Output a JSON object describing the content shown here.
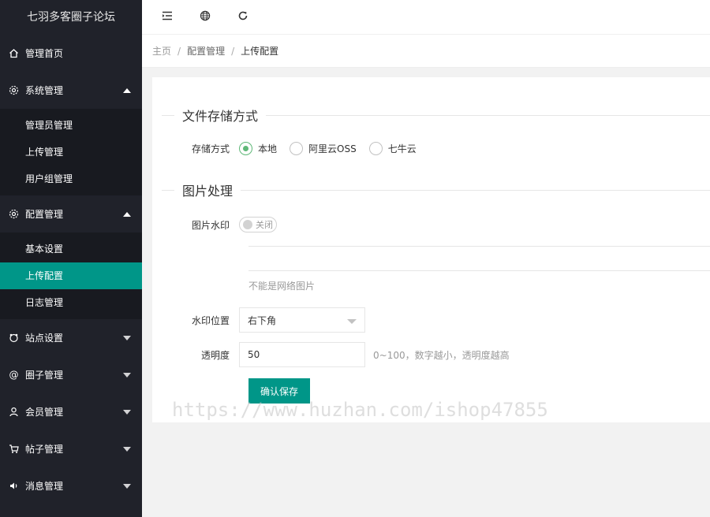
{
  "app": {
    "title": "七羽多客圈子论坛"
  },
  "sidebar": {
    "items": [
      {
        "label": "管理首页",
        "icon": "home-icon"
      },
      {
        "label": "系统管理",
        "icon": "gear-icon",
        "expanded": true,
        "children": [
          {
            "label": "管理员管理"
          },
          {
            "label": "上传管理"
          },
          {
            "label": "用户组管理"
          }
        ]
      },
      {
        "label": "配置管理",
        "icon": "gear-icon",
        "expanded": true,
        "children": [
          {
            "label": "基本设置"
          },
          {
            "label": "上传配置",
            "active": true
          },
          {
            "label": "日志管理"
          }
        ]
      },
      {
        "label": "站点设置",
        "icon": "bear-icon"
      },
      {
        "label": "圈子管理",
        "icon": "at-icon"
      },
      {
        "label": "会员管理",
        "icon": "user-icon"
      },
      {
        "label": "帖子管理",
        "icon": "cart-icon"
      },
      {
        "label": "消息管理",
        "icon": "speaker-icon"
      }
    ]
  },
  "header": {
    "tools": [
      {
        "icon": "menu-fold-icon"
      },
      {
        "icon": "globe-icon"
      },
      {
        "icon": "refresh-icon"
      }
    ]
  },
  "breadcrumb": {
    "home": "主页",
    "section": "配置管理",
    "current": "上传配置"
  },
  "form": {
    "section_storage": "文件存储方式",
    "storage_label": "存储方式",
    "storage_options": [
      {
        "label": "本地",
        "checked": true
      },
      {
        "label": "阿里云OSS",
        "checked": false
      },
      {
        "label": "七牛云",
        "checked": false
      }
    ],
    "section_image": "图片处理",
    "watermark_label": "图片水印",
    "watermark_switch": "关闭",
    "watermark_hint": "不能是网络图片",
    "position_label": "水印位置",
    "position_value": "右下角",
    "opacity_label": "透明度",
    "opacity_value": "50",
    "opacity_hint": "0~100，数字越小，透明度越高",
    "submit_label": "确认保存"
  },
  "watermark_text": "https://www.huzhan.com/ishop47855",
  "colors": {
    "sidebar_bg": "#20222a",
    "submenu_bg": "#181a20",
    "accent": "#009688",
    "radio_checked": "#5fb878"
  }
}
